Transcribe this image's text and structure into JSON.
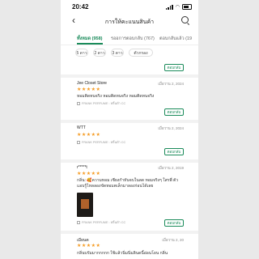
{
  "status": {
    "time": "20:42"
  },
  "header": {
    "back": "‹",
    "title": "การให้คะแนนสินค้า"
  },
  "tabs": [
    "ทั้งหมด (958)",
    "รออการตอบกลับ (767)",
    "ตอบกลับแล้ว (19"
  ],
  "filters": [
    "5 ดาว",
    "2 ดาว",
    "3 ดาว",
    "ตัวกรอง"
  ],
  "reply_label": "ตอบกลับ",
  "stars": "★★★★★",
  "reviews": [
    {
      "name": "Jee Closet Store",
      "date": "เมื่อวาน 2, 2024",
      "text": "หอมติดทนจริง หอมติดทนจริง หอมติดทนจริง",
      "variant": "FRANK PERFUME : หลิ้นดำ CC"
    },
    {
      "name": "WTT",
      "date": "เมื่อวาน 2, 2024",
      "text": "",
      "variant": "FRANK PERFUME : หลิ้นดำ CC"
    },
    {
      "name": "r*****t",
      "date": "เมื่อวาน 2, 2019",
      "text": "กลิ่น: 🥰ความหอม เชียงกำหันจบในลด หอมจริงๆ ใสรพี่ ตัวแอบรู้ไหลลองขัดหอมตเล็กมาลองก่อนได้เลย",
      "variant": "FRANK PERFUME : หลิ้นดำ CC"
    },
    {
      "name": "เมียนต",
      "date": "เมื่อวาน 2, 20",
      "text": "กลิ่นบรัมมากกกกก ใช้แล้วนิ่มนิ่มลินดนี้อ่อนโยน กลิ่น",
      "variant": ""
    }
  ]
}
